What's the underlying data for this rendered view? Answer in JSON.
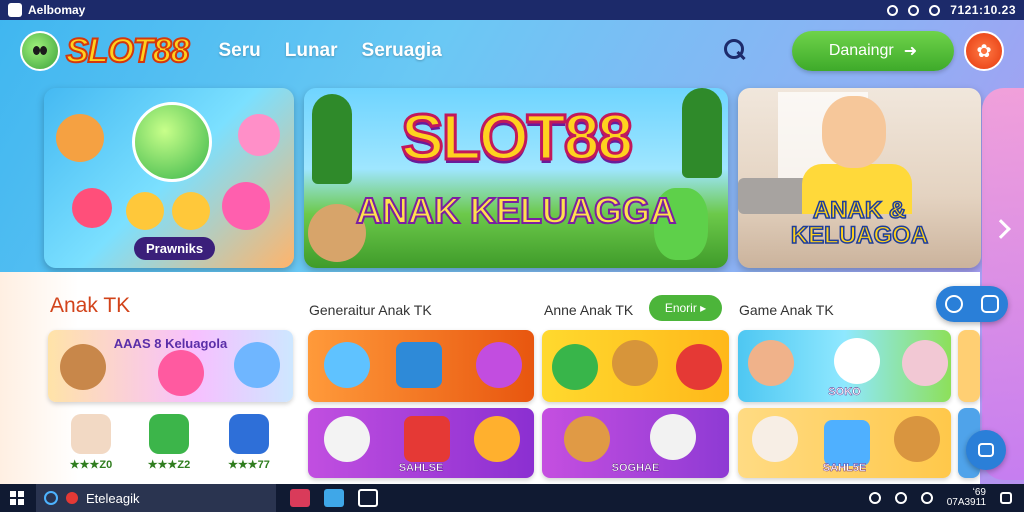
{
  "statusbar": {
    "app_name": "Aelbomay",
    "time": "7121:10.23"
  },
  "header": {
    "logo_text": "SLOT88",
    "nav": [
      "Seru",
      "Lunar",
      "Seruagia"
    ],
    "cta_label": "Danaingr",
    "cta_arrow": "➜",
    "avatar_glyph": "✿"
  },
  "banners": {
    "b1_pill": "Prawniks",
    "b2_title": "SLOT88",
    "b2_subtitle": "ANAK KELUAGGA",
    "b3_line1": "ANAK &",
    "b3_line2": "KELUAGOA"
  },
  "sections": {
    "main_title": "Anak TK",
    "col2_title": "Generaitur Anak TK",
    "col3_title": "Anne Anak TK",
    "col3_button": "Enorir ▸",
    "col4_title": "Game Anak TK"
  },
  "cards": {
    "a_caption": "AAAS 8 Keluagola",
    "d_caption": "SOKO",
    "e_caption": "SAHLSE",
    "f_caption": "SOGHAE",
    "g_caption": "SAHL5E"
  },
  "small_items": [
    {
      "label": "★★★Z0"
    },
    {
      "label": "★★★Z2"
    },
    {
      "label": "★★★77"
    }
  ],
  "taskbar": {
    "search_text": "Eteleagik",
    "clock_line1": "ʻ69",
    "clock_line2": "07A3911"
  },
  "colors": {
    "accent_green": "#4cb53a",
    "brand_yellow": "#ffd21f",
    "header_blue": "#1c2a6a"
  }
}
